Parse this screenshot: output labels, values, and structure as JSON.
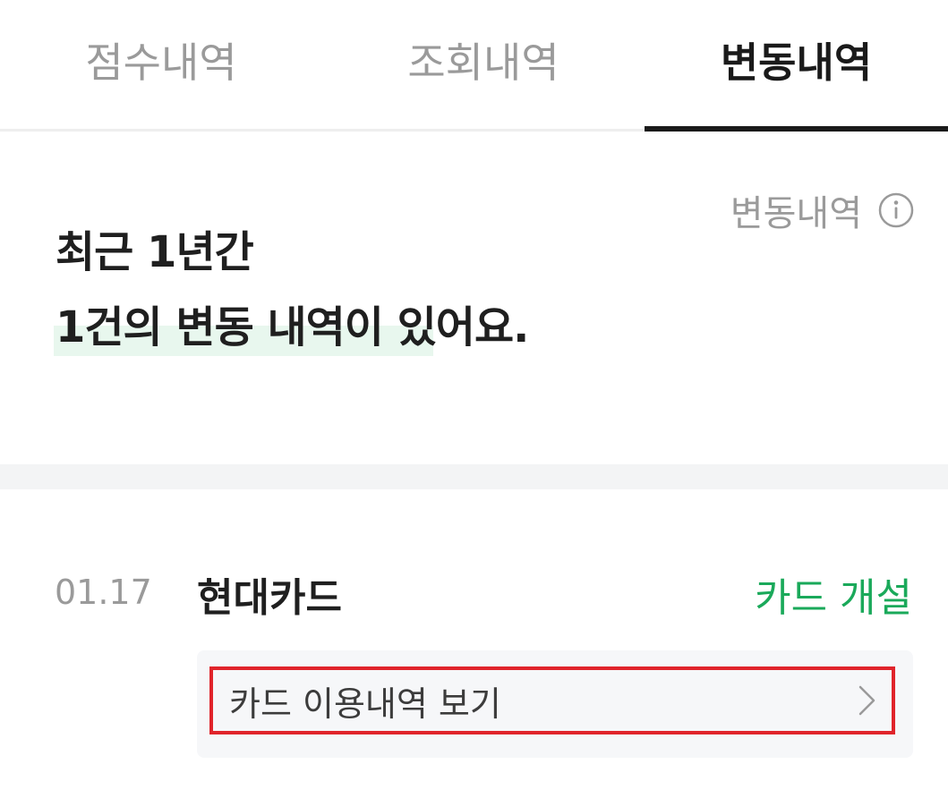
{
  "tabs": [
    {
      "label": "점수내역",
      "active": false
    },
    {
      "label": "조회내역",
      "active": false
    },
    {
      "label": "변동내역",
      "active": true
    }
  ],
  "info_link": {
    "label": "변동내역",
    "icon": "info-icon"
  },
  "headline": {
    "line1": "최근 1년간",
    "line2": "1건의 변동 내역이 있어요."
  },
  "entries": [
    {
      "date": "01.17",
      "title": "현대카드",
      "status": "카드 개설",
      "link_label": "카드 이용내역 보기",
      "link_icon": "chevron-right-icon"
    }
  ],
  "colors": {
    "accent_green": "#1aa95a",
    "highlight": "#e8f7ee",
    "selection_box": "#e0242b"
  }
}
